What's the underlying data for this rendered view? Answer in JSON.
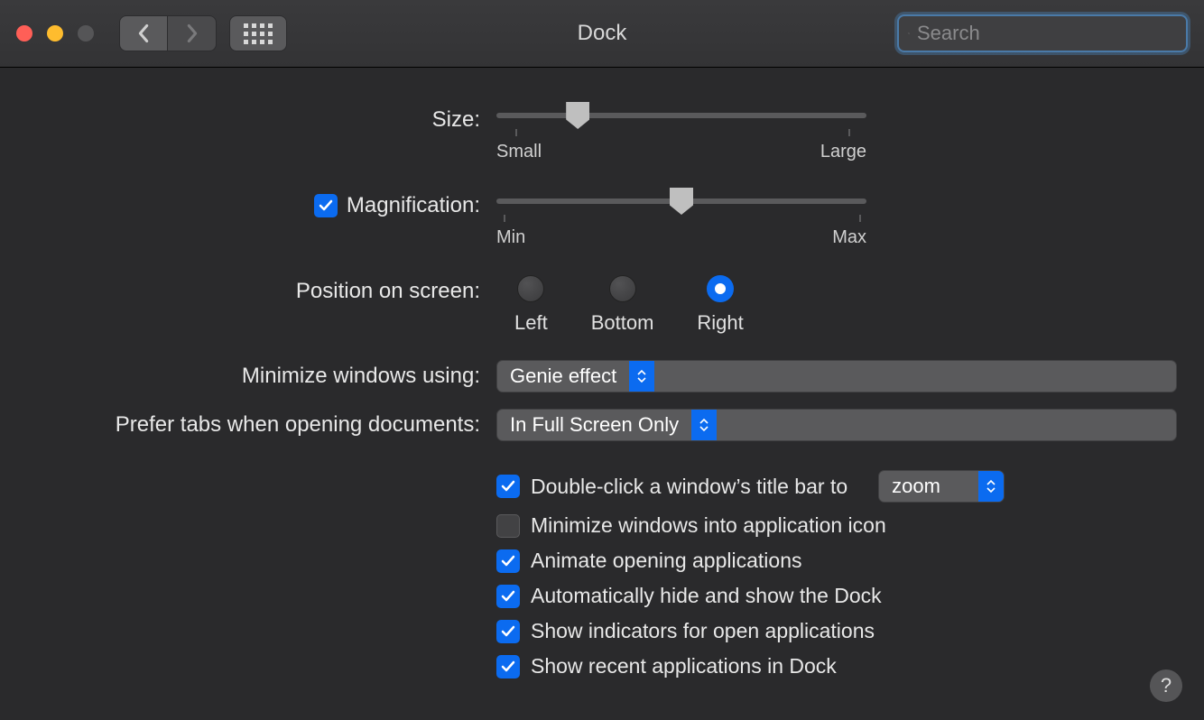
{
  "titlebar": {
    "title": "Dock",
    "search_placeholder": "Search"
  },
  "size": {
    "label": "Size:",
    "min_label": "Small",
    "max_label": "Large",
    "value_pct": 22
  },
  "magnification": {
    "label": "Magnification:",
    "checked": true,
    "min_label": "Min",
    "max_label": "Max",
    "value_pct": 50
  },
  "position": {
    "label": "Position on screen:",
    "options": {
      "left": "Left",
      "bottom": "Bottom",
      "right": "Right"
    },
    "selected": "right"
  },
  "minimize_using": {
    "label": "Minimize windows using:",
    "value": "Genie effect"
  },
  "prefer_tabs": {
    "label": "Prefer tabs when opening documents:",
    "value": "In Full Screen Only"
  },
  "double_click": {
    "checked": true,
    "label": "Double-click a window’s title bar to",
    "value": "zoom"
  },
  "checks": {
    "minimize_into_app": {
      "checked": false,
      "label": "Minimize windows into application icon"
    },
    "animate_opening": {
      "checked": true,
      "label": "Animate opening applications"
    },
    "auto_hide": {
      "checked": true,
      "label": "Automatically hide and show the Dock"
    },
    "show_indicators": {
      "checked": true,
      "label": "Show indicators for open applications"
    },
    "show_recent": {
      "checked": true,
      "label": "Show recent applications in Dock"
    }
  },
  "help_label": "?"
}
